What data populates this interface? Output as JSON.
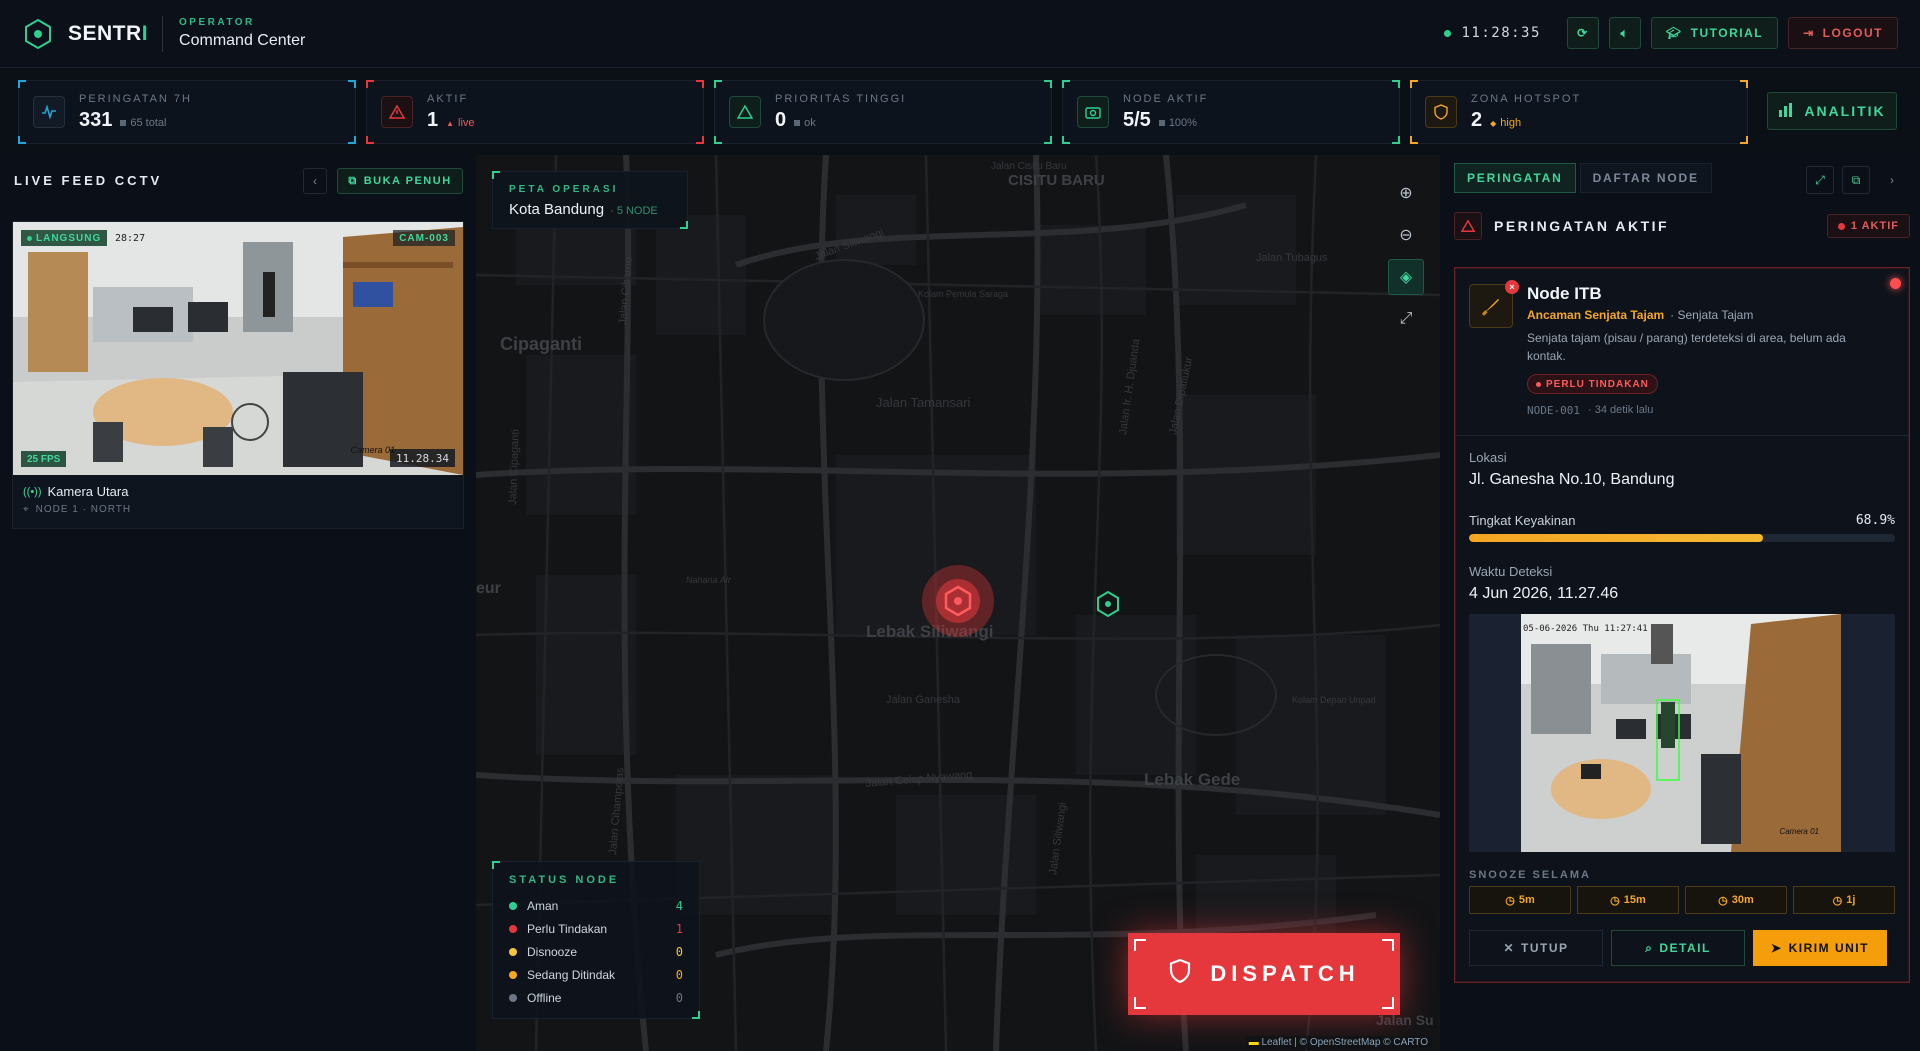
{
  "header": {
    "brand": "SENTR",
    "brand_accent": "I",
    "operator_label": "OPERATOR",
    "operator_title": "Command Center",
    "clock": "11:28:35",
    "tutorial_label": "TUTORIAL",
    "logout_label": "LOGOUT",
    "icons": {
      "refresh": "refresh-icon",
      "sound": "volume-icon"
    }
  },
  "stats": [
    {
      "label": "PERINGATAN 7H",
      "value": "331",
      "sub": "65 total",
      "color": "#1ea7d8",
      "icon": "activity-icon"
    },
    {
      "label": "AKTIF",
      "value": "1",
      "sub": "live",
      "sub_color": "#e45b5b",
      "color": "#e5383c",
      "icon": "alert-triangle-icon"
    },
    {
      "label": "PRIORITAS TINGGI",
      "value": "0",
      "sub": "ok",
      "color": "#2fcf8f",
      "icon": "warning-icon"
    },
    {
      "label": "NODE AKTIF",
      "value": "5/5",
      "sub": "100%",
      "color": "#2fcf8f",
      "icon": "camera-icon"
    },
    {
      "label": "ZONA HOTSPOT",
      "value": "2",
      "sub": "high",
      "sub_color": "#f5a623",
      "color": "#f5a623",
      "icon": "shield-icon"
    }
  ],
  "analitik_label": "ANALITIK",
  "left": {
    "title": "LIVE FEED CCTV",
    "open_label": "BUKA PENUH",
    "camera": {
      "live_badge": "LANGSUNG",
      "cam_id": "CAM-003",
      "fps": "25 FPS",
      "time": "11.28.34",
      "overlay_date": "28:27",
      "overlay_label": "Camera 01",
      "name": "Kamera Utara",
      "node": "NODE 1 · NORTH"
    }
  },
  "map": {
    "peta_label": "PETA OPERASI",
    "city": "Kota Bandung",
    "nodes": "· 5 NODE",
    "place_labels": [
      "CISITU BARU",
      "Cipaganti",
      "Lebak Siliwangi",
      "Lebak Gede",
      "eur",
      "Jalan Su"
    ],
    "street_labels": [
      "Jalan Siliwangi",
      "Jalan Tamansari",
      "Jalan Ganesha",
      "Jalan Cibarno",
      "Jalan Ir. H. Djuanda",
      "Jalan Dipatiukur",
      "Jalan Cisitu Baru",
      "Jalan Tubagus",
      "Kolam Pemula Saraga",
      "Nahana Air",
      "Kolam Depan Unpad",
      "Jalan Cipaganti",
      "Jalan Cihampelas",
      "Jalan Celap Nyawang",
      "Jalan Siliwangi"
    ],
    "status": {
      "title": "STATUS NODE",
      "rows": [
        {
          "label": "Aman",
          "count": "4",
          "color": "#2fcf8f"
        },
        {
          "label": "Perlu Tindakan",
          "count": "1",
          "color": "#e5383c"
        },
        {
          "label": "Disnooze",
          "count": "0",
          "color": "#f5c542"
        },
        {
          "label": "Sedang Ditindak",
          "count": "0",
          "color": "#f5a623"
        },
        {
          "label": "Offline",
          "count": "0",
          "color": "#6b7786"
        }
      ]
    },
    "dispatch_label": "DISPATCH",
    "attribution": {
      "leaflet": "Leaflet",
      "osm": "© OpenStreetMap",
      "carto": "© CARTO"
    }
  },
  "right": {
    "tabs": [
      "PERINGATAN",
      "DAFTAR NODE"
    ],
    "section_title": "PERINGATAN AKTIF",
    "active_badge": "1 AKTIF",
    "alert": {
      "node": "Node ITB",
      "type": "Ancaman Senjata Tajam",
      "category": "· Senjata Tajam",
      "description": "Senjata tajam (pisau / parang) terdeteksi di area, belum ada kontak.",
      "tag": "PERLU TINDAKAN",
      "node_id": "NODE-001",
      "ago": "· 34 detik lalu",
      "location_label": "Lokasi",
      "location": "Jl. Ganesha No.10, Bandung",
      "confidence_label": "Tingkat Keyakinan",
      "confidence": "68.9%",
      "confidence_fraction": 0.689,
      "time_label": "Waktu Deteksi",
      "time": "4 Jun 2026, 11.27.46",
      "snapshot_timestamp": "05-06-2026 Thu 11:27:41",
      "snapshot_label": "Camera 01",
      "snooze_label": "SNOOZE SELAMA",
      "snooze": [
        "5m",
        "15m",
        "30m",
        "1j"
      ],
      "actions": {
        "close": "TUTUP",
        "detail": "DETAIL",
        "send": "KIRIM UNIT"
      }
    }
  }
}
